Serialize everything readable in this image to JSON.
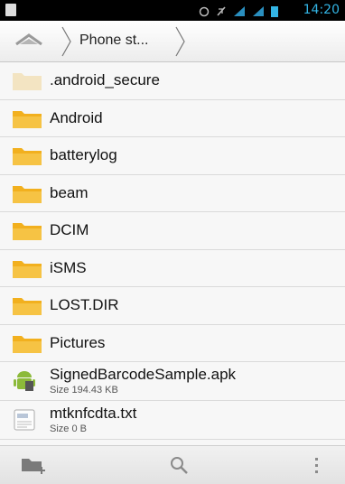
{
  "status_bar": {
    "time": "14:20"
  },
  "path": {
    "crumb": "Phone st..."
  },
  "files": [
    {
      "name": ".android_secure",
      "type": "folder-faded"
    },
    {
      "name": "Android",
      "type": "folder"
    },
    {
      "name": "batterylog",
      "type": "folder"
    },
    {
      "name": "beam",
      "type": "folder"
    },
    {
      "name": "DCIM",
      "type": "folder"
    },
    {
      "name": "iSMS",
      "type": "folder"
    },
    {
      "name": "LOST.DIR",
      "type": "folder"
    },
    {
      "name": "Pictures",
      "type": "folder"
    },
    {
      "name": "SignedBarcodeSample.apk",
      "size": "Size 194.43 KB",
      "type": "apk"
    },
    {
      "name": "mtknfcdta.txt",
      "size": "Size 0 B",
      "type": "txt"
    }
  ],
  "colors": {
    "folder": "#f2b01e",
    "status_accent": "#33b5e5"
  }
}
